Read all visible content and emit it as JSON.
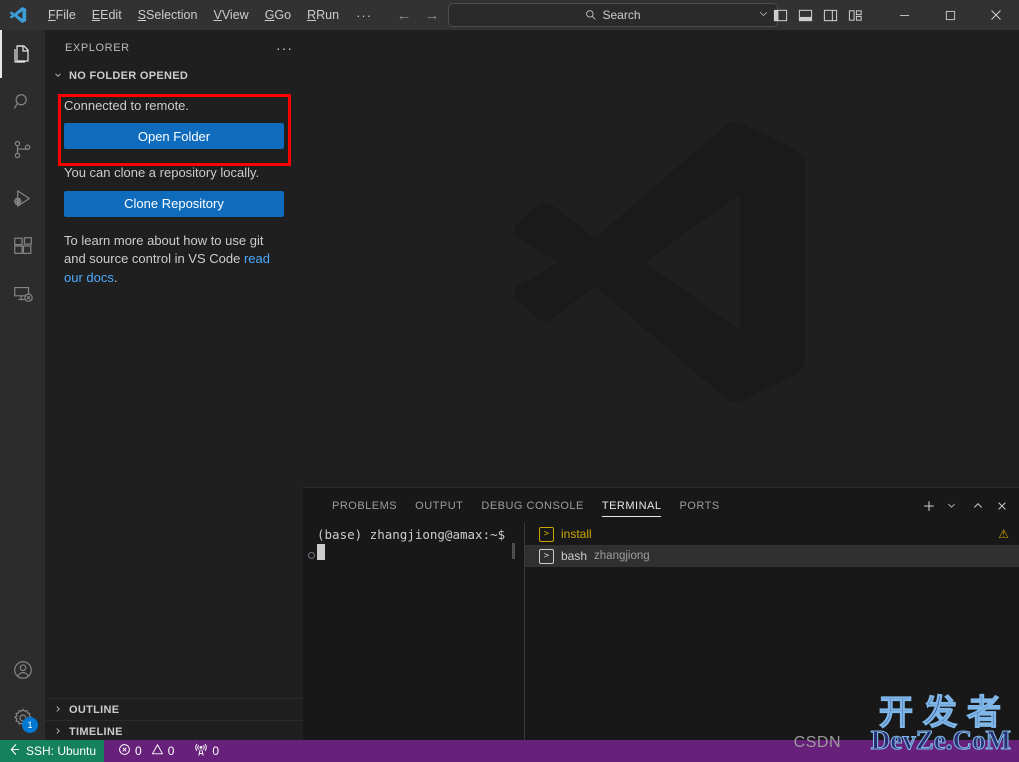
{
  "titlebar": {
    "logo_icon": "vscode-logo-icon",
    "menus": [
      {
        "label": "File",
        "accel": "F"
      },
      {
        "label": "Edit",
        "accel": "E"
      },
      {
        "label": "Selection",
        "accel": "S"
      },
      {
        "label": "View",
        "accel": "V"
      },
      {
        "label": "Go",
        "accel": "G"
      },
      {
        "label": "Run",
        "accel": "R"
      }
    ],
    "more_label": "···",
    "back_arrow": "←",
    "forward_arrow": "→",
    "search": {
      "placeholder": "Search",
      "value": "Search",
      "icon": "search-icon",
      "chevron": "⌄"
    },
    "layout_icons": [
      "toggle-primary-sidebar-icon",
      "toggle-panel-icon",
      "toggle-secondary-sidebar-icon",
      "customize-layout-icon"
    ],
    "window_controls": {
      "minimize": "—",
      "maximize": "□",
      "close": "✕"
    }
  },
  "activitybar": {
    "items": [
      {
        "name": "explorer",
        "icon": "files-icon",
        "active": true
      },
      {
        "name": "search",
        "icon": "search-icon",
        "active": false
      },
      {
        "name": "source-control",
        "icon": "source-control-icon",
        "active": false
      },
      {
        "name": "run-and-debug",
        "icon": "run-debug-icon",
        "active": false
      },
      {
        "name": "extensions",
        "icon": "extensions-icon",
        "active": false
      },
      {
        "name": "remote-explorer",
        "icon": "remote-explorer-icon",
        "active": false
      }
    ],
    "bottom": [
      {
        "name": "accounts",
        "icon": "account-icon",
        "badge": null
      },
      {
        "name": "manage",
        "icon": "gear-icon",
        "badge": "1"
      }
    ]
  },
  "sidebar": {
    "title": "EXPLORER",
    "more_actions": "···",
    "section": {
      "label": "NO FOLDER OPENED",
      "expanded": true,
      "twisty": "⌄"
    },
    "connected_text": "Connected to remote.",
    "open_folder_button": "Open Folder",
    "clone_text": "You can clone a repository locally.",
    "clone_button": "Clone Repository",
    "docs_text_before": "To learn more about how to use git and source control in VS Code ",
    "docs_link": "read our docs",
    "docs_text_after": ".",
    "collapsed_sections": [
      {
        "label": "OUTLINE",
        "twisty": "›"
      },
      {
        "label": "TIMELINE",
        "twisty": "›"
      }
    ]
  },
  "editor": {
    "watermark_icon": "vscode-logo-watermark-icon"
  },
  "panel": {
    "tabs": [
      {
        "label": "PROBLEMS",
        "active": false
      },
      {
        "label": "OUTPUT",
        "active": false
      },
      {
        "label": "DEBUG CONSOLE",
        "active": false
      },
      {
        "label": "TERMINAL",
        "active": true
      },
      {
        "label": "PORTS",
        "active": false
      }
    ],
    "actions": {
      "new_terminal": "+",
      "new_terminal_chevron": "⌄",
      "maximize": "⌃",
      "close": "✕"
    },
    "terminal": {
      "prompt": "(base) zhangjiong@amax:~$",
      "cursor": "",
      "tabs": [
        {
          "label": "install",
          "description": "",
          "state": "warning",
          "selected": false,
          "icon": "terminal-icon",
          "warn_icon": "⚠"
        },
        {
          "label": "bash",
          "description": "zhangjiong",
          "state": "normal",
          "selected": true,
          "icon": "terminal-icon",
          "warn_icon": ""
        }
      ]
    }
  },
  "statusbar": {
    "remote": {
      "icon": "remote-host-icon",
      "label": "SSH: Ubuntu"
    },
    "problems": {
      "error_icon": "error-circle-icon",
      "errors": "0",
      "warning_icon": "warning-triangle-icon",
      "warnings": "0"
    },
    "ports": {
      "icon": "radio-tower-icon",
      "count": "0"
    }
  },
  "watermark": {
    "chinese": "开发者",
    "site": "DevZe.CoM",
    "brand": "CSDN"
  },
  "colors": {
    "accent_blue": "#0f6cbd",
    "status_purple": "#68217a",
    "remote_green": "#16825d",
    "highlight_red": "#ff0000",
    "warning_yellow": "#cca700",
    "link_blue": "#4daafc"
  }
}
